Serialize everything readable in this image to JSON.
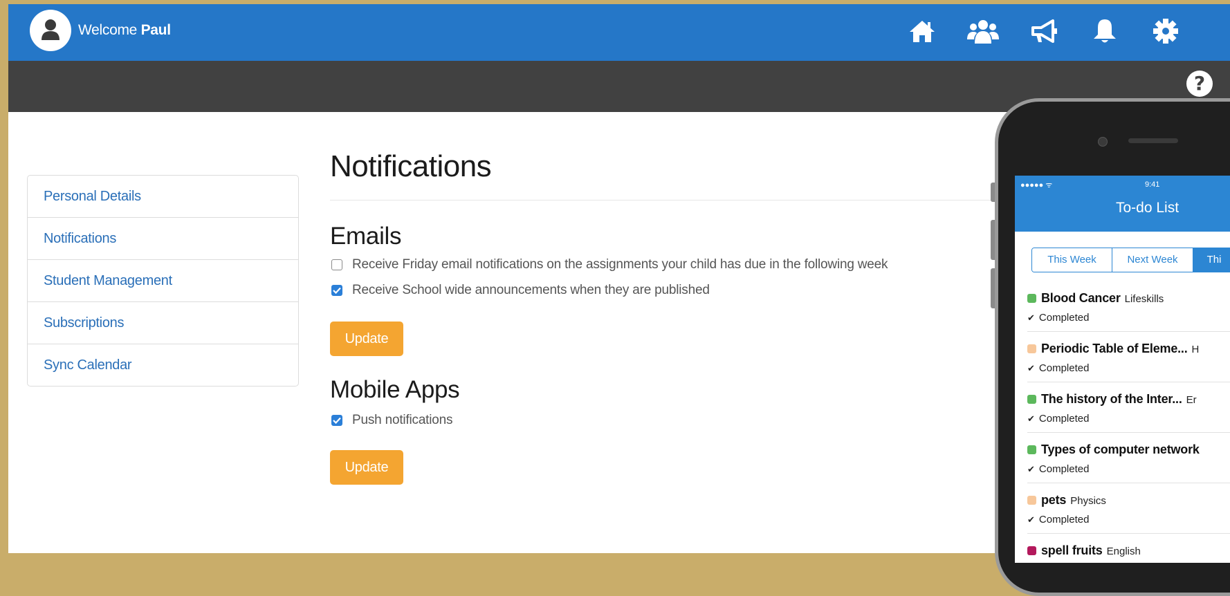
{
  "header": {
    "welcome_prefix": "Welcome",
    "user_name": "Paul",
    "nav_icons": [
      "home-icon",
      "users-icon",
      "megaphone-icon",
      "bell-icon",
      "gear-icon"
    ],
    "help_symbol": "?"
  },
  "colors": {
    "topbar": "#2577c8",
    "darkbar": "#414141",
    "link": "#2a6fb8",
    "button": "#f4a531",
    "checkbox_checked": "#2b7fd8"
  },
  "sidebar": {
    "items": [
      {
        "label": "Personal Details"
      },
      {
        "label": "Notifications"
      },
      {
        "label": "Student Management"
      },
      {
        "label": "Subscriptions"
      },
      {
        "label": "Sync Calendar"
      }
    ]
  },
  "main": {
    "title": "Notifications",
    "emails": {
      "heading": "Emails",
      "options": [
        {
          "label": "Receive Friday email notifications on the assignments your child has due in the following week",
          "checked": false
        },
        {
          "label": "Receive School wide announcements when they are published",
          "checked": true
        }
      ],
      "update_label": "Update"
    },
    "mobile_apps": {
      "heading": "Mobile Apps",
      "options": [
        {
          "label": "Push notifications",
          "checked": true
        }
      ],
      "update_label": "Update"
    }
  },
  "phone": {
    "status_signal": "●●●●● ᯤ",
    "status_time": "9:41",
    "title": "To-do List",
    "segments": [
      "This Week",
      "Next Week",
      "Thi"
    ],
    "active_segment": 2,
    "todos": [
      {
        "name": "Blood Cancer",
        "subject": "Lifeskills",
        "status": "Completed",
        "color": "#5cb85c"
      },
      {
        "name": "Periodic Table of Eleme...",
        "subject": "H",
        "status": "Completed",
        "color": "#f7c79a"
      },
      {
        "name": "The history of the Inter...",
        "subject": "Er",
        "status": "Completed",
        "color": "#5cb85c"
      },
      {
        "name": "Types of computer network",
        "subject": "",
        "status": "Completed",
        "color": "#5cb85c"
      },
      {
        "name": "pets",
        "subject": "Physics",
        "status": "Completed",
        "color": "#f7c79a"
      },
      {
        "name": "spell fruits",
        "subject": "English",
        "status": "",
        "color": "#b3195c"
      }
    ]
  }
}
